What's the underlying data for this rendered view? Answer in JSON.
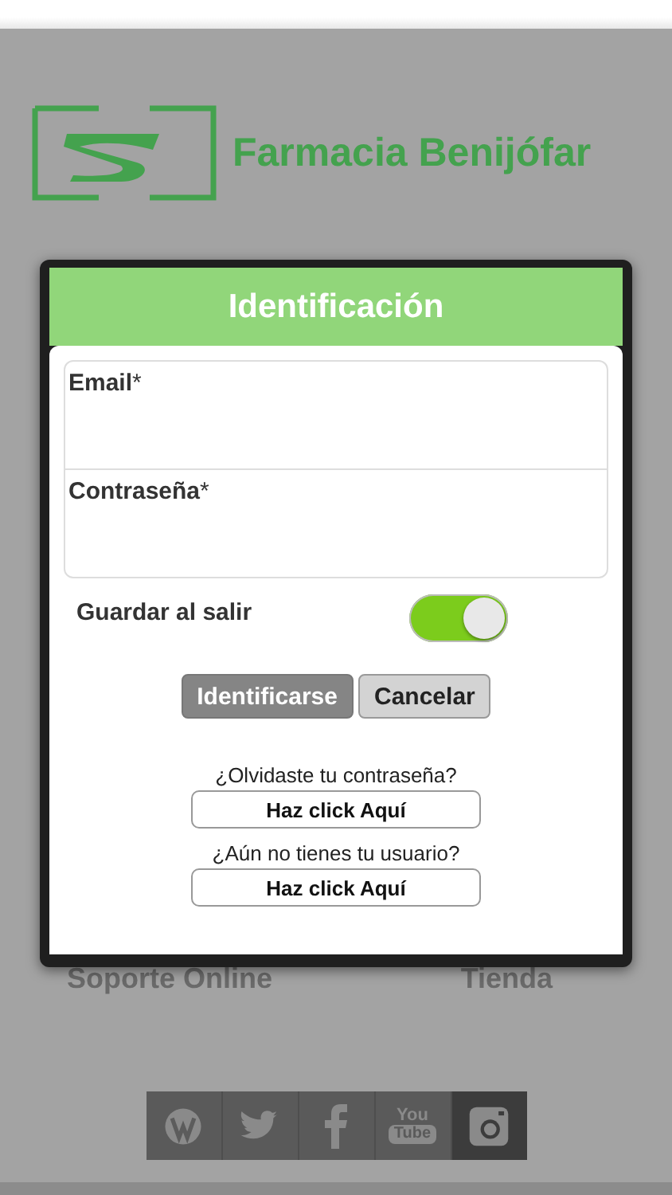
{
  "brand": {
    "name": "Farmacia Benijófar"
  },
  "menu": [
    {
      "label": "Soporte Online"
    },
    {
      "label": "Tienda"
    }
  ],
  "social": [
    {
      "kind": "wordpress"
    },
    {
      "kind": "twitter"
    },
    {
      "kind": "facebook"
    },
    {
      "kind": "youtube",
      "logo_text": [
        "You",
        "Tube"
      ]
    },
    {
      "kind": "instagram"
    }
  ],
  "dialog": {
    "title": "Identificación",
    "fields": [
      {
        "label": "Email",
        "required_mark": "*"
      },
      {
        "label": "Contraseña",
        "required_mark": "*"
      }
    ],
    "remember": {
      "label": "Guardar al salir",
      "on": true
    },
    "buttons": [
      {
        "label": "Identificarse",
        "kind": "primary"
      },
      {
        "label": "Cancelar",
        "kind": "secondary"
      }
    ],
    "links": [
      {
        "prompt": "¿Olvidaste tu contraseña?",
        "button": "Haz click Aquí"
      },
      {
        "prompt": "¿Aún no tienes tu usuario?",
        "button": "Haz click Aquí"
      }
    ]
  }
}
